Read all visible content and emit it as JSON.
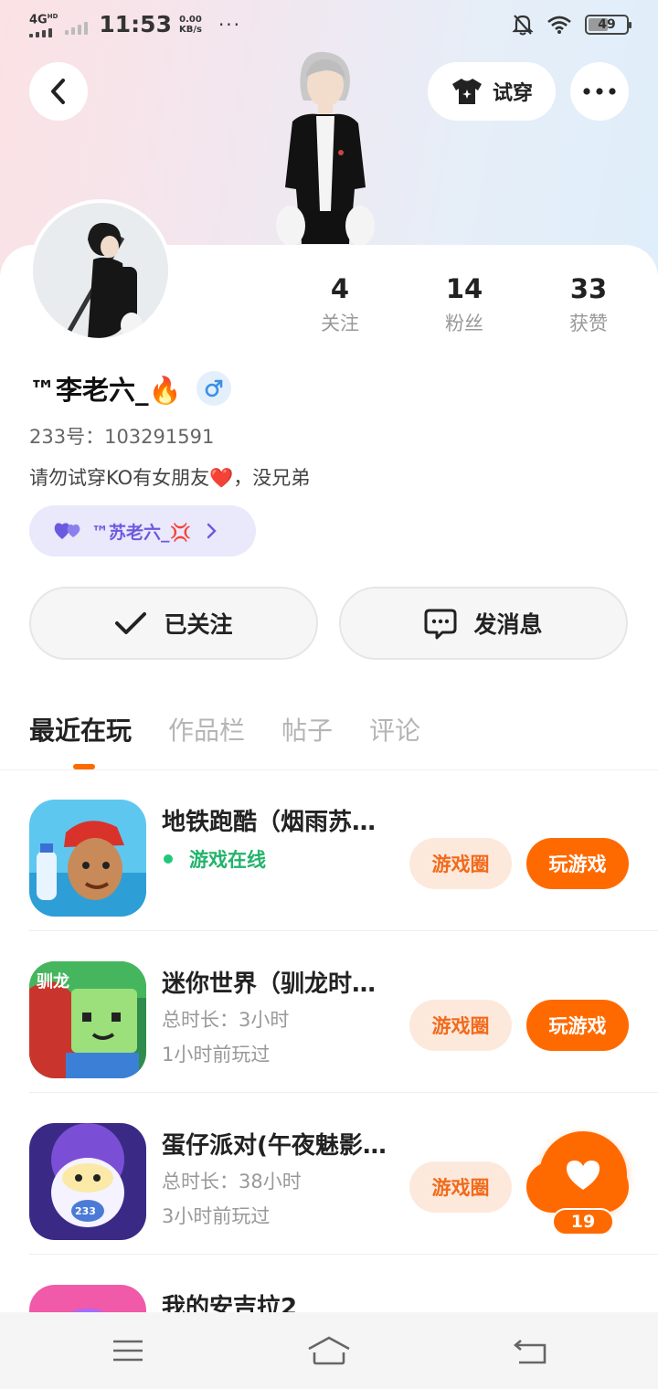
{
  "status_bar": {
    "network": "4G",
    "network_sup": "HD",
    "time": "11:53",
    "speed_value": "0.00",
    "speed_unit": "KB/s",
    "dots": "···",
    "battery": "49"
  },
  "header": {
    "tryon_label": "试穿"
  },
  "profile": {
    "stats": [
      {
        "value": "4",
        "label": "关注"
      },
      {
        "value": "14",
        "label": "粉丝"
      },
      {
        "value": "33",
        "label": "获赞"
      }
    ],
    "nickname": "™李老六_🔥",
    "uid": "233号：103291591",
    "bio": "请勿试穿KO有女朋友❤️，没兄弟",
    "cp_name": "™苏老六_💢"
  },
  "actions": {
    "follow_label": "已关注",
    "message_label": "发消息"
  },
  "tabs": [
    "最近在玩",
    "作品栏",
    "帖子",
    "评论"
  ],
  "games": [
    {
      "title": "地铁跑酷（烟雨苏…",
      "status": "游戏在线",
      "circle_label": "游戏圈",
      "play_label": "玩游戏"
    },
    {
      "title": "迷你世界（驯龙时…",
      "duration": "总时长：3小时",
      "last_played": "1小时前玩过",
      "circle_label": "游戏圈",
      "play_label": "玩游戏"
    },
    {
      "title": "蛋仔派对(午夜魅影…",
      "duration": "总时长：38小时",
      "last_played": "3小时前玩过",
      "circle_label": "游戏圈",
      "play_label": "玩游戏"
    },
    {
      "title": "我的安吉拉2"
    }
  ],
  "like_count": "19",
  "colors": {
    "accent": "#ff6a00",
    "online": "#22b36b",
    "cp_purple": "#6a5ae0"
  }
}
